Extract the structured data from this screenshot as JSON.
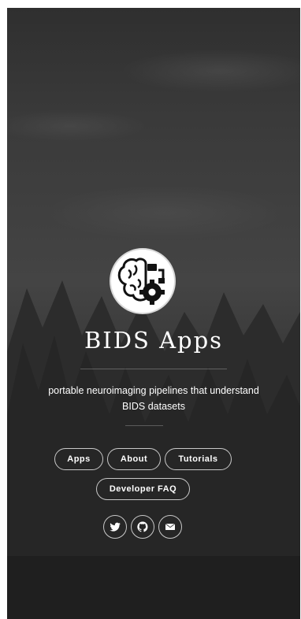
{
  "site": {
    "title": "BIDS Apps",
    "tagline_line1": "portable neuroimaging pipelines that understand",
    "tagline_line2": "BIDS datasets"
  },
  "nav": {
    "apps": "Apps",
    "about": "About",
    "tutorials": "Tutorials",
    "developer_faq": "Developer FAQ"
  },
  "social": [
    "twitter-icon",
    "github-icon",
    "email-icon"
  ],
  "colors": {
    "text": "#ffffff",
    "background": "#3a3a3a",
    "logo_bg": "#ffffff"
  }
}
